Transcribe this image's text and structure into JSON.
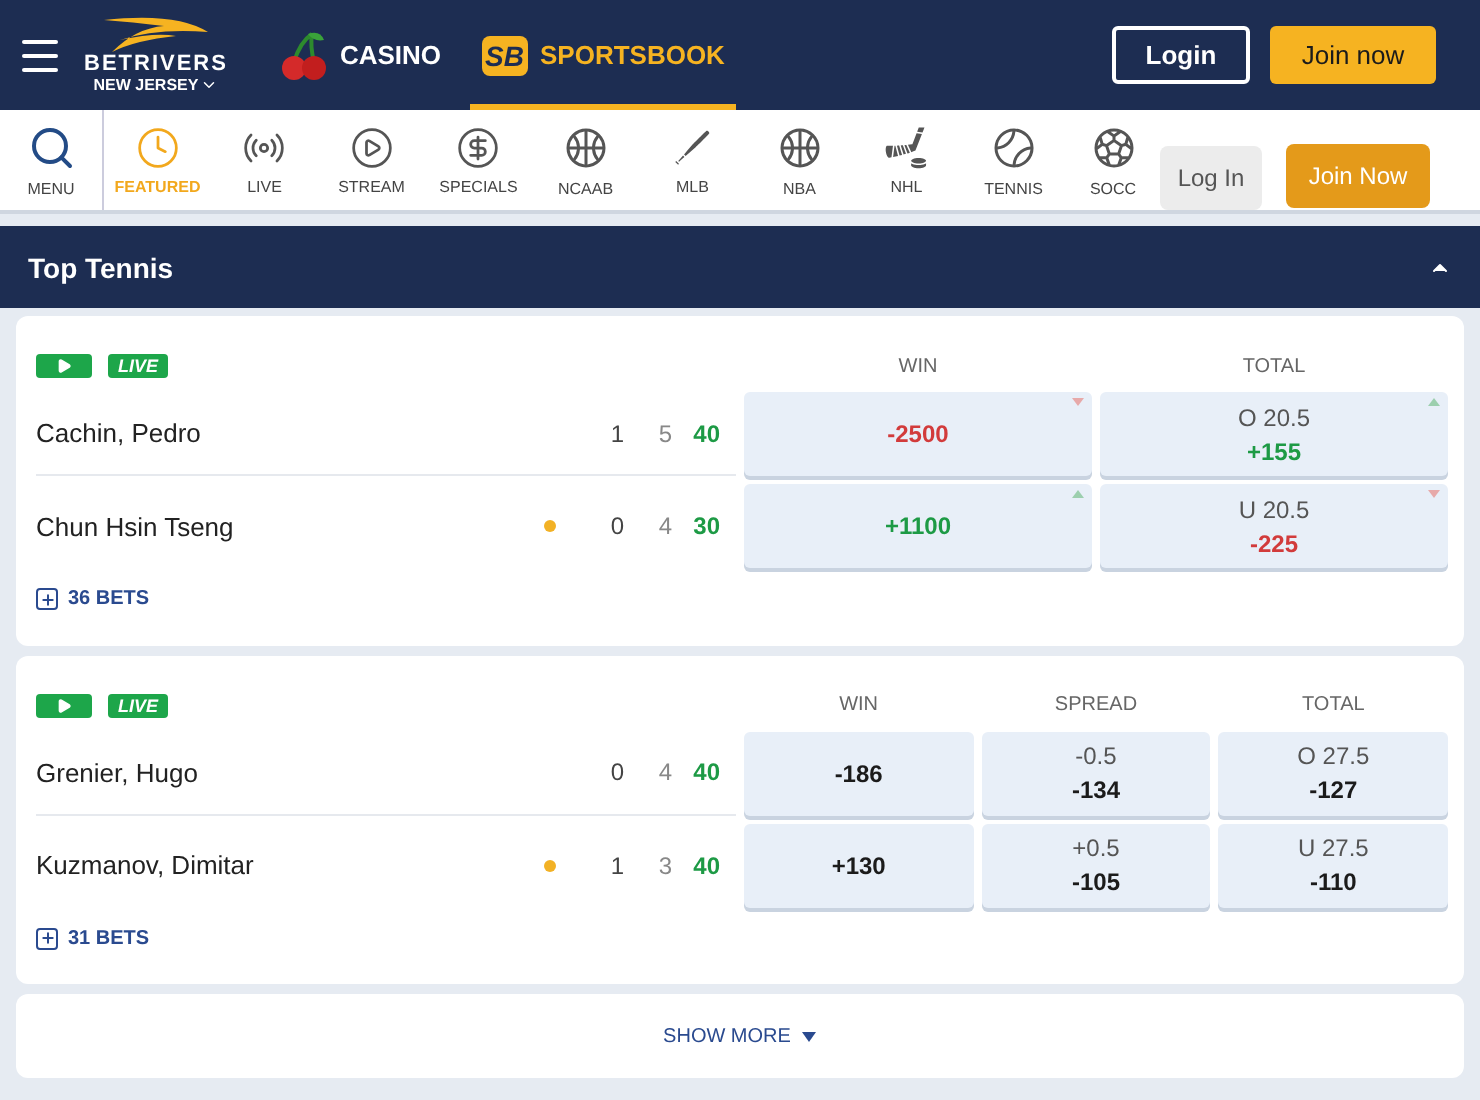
{
  "header": {
    "brand": "BETRIVERS",
    "region": "NEW JERSEY",
    "products": [
      {
        "kind": "casino",
        "label": "CASINO",
        "selected": false
      },
      {
        "kind": "sportsbook",
        "logo": "SB",
        "label": "SPORTSBOOK",
        "selected": true
      }
    ],
    "login": "Login",
    "join": "Join now"
  },
  "nav": {
    "items": [
      {
        "kind": "search",
        "label": "MENU",
        "selected": false
      },
      {
        "kind": "clock",
        "label": "FEATURED",
        "selected": true
      },
      {
        "kind": "live",
        "label": "LIVE",
        "selected": false
      },
      {
        "kind": "stream",
        "label": "STREAM",
        "selected": false
      },
      {
        "kind": "dollar",
        "label": "SPECIALS",
        "selected": false
      },
      {
        "kind": "basketball",
        "label": "NCAAB",
        "selected": false
      },
      {
        "kind": "bat",
        "label": "MLB",
        "selected": false
      },
      {
        "kind": "basketball",
        "label": "NBA",
        "selected": false
      },
      {
        "kind": "hockey",
        "label": "NHL",
        "selected": false
      },
      {
        "kind": "tennis",
        "label": "TENNIS",
        "selected": false
      },
      {
        "kind": "soccer",
        "label": "SOCC",
        "selected": false
      }
    ],
    "overlay_login": "Log In",
    "overlay_join": "Join Now"
  },
  "section": {
    "title": "Top Tennis",
    "expanded": true
  },
  "matches": [
    {
      "badge": "LIVE",
      "columns": [
        "WIN",
        "TOTAL"
      ],
      "bets": "36 BETS",
      "players": [
        {
          "name": "Cachin, Pedro",
          "serving": false,
          "scores": [
            "1",
            "5",
            "40"
          ],
          "odds": [
            {
              "price": "-2500",
              "rising": false,
              "falling": true
            },
            {
              "line": "O 20.5",
              "price": "+155",
              "rising": true,
              "falling": false
            }
          ]
        },
        {
          "name": "Chun Hsin Tseng",
          "serving": true,
          "scores": [
            "0",
            "4",
            "30"
          ],
          "odds": [
            {
              "price": "+1100",
              "rising": true,
              "falling": false
            },
            {
              "line": "U 20.5",
              "price": "-225",
              "rising": false,
              "falling": true
            }
          ]
        }
      ]
    },
    {
      "badge": "LIVE",
      "columns": [
        "WIN",
        "SPREAD",
        "TOTAL"
      ],
      "bets": "31 BETS",
      "players": [
        {
          "name": "Grenier, Hugo",
          "serving": false,
          "scores": [
            "0",
            "4",
            "40"
          ],
          "odds": [
            {
              "price": "-186",
              "rising": false,
              "falling": false
            },
            {
              "line": "-0.5",
              "price": "-134",
              "rising": false,
              "falling": false
            },
            {
              "line": "O 27.5",
              "price": "-127",
              "rising": false,
              "falling": false
            }
          ]
        },
        {
          "name": "Kuzmanov, Dimitar",
          "serving": true,
          "scores": [
            "1",
            "3",
            "40"
          ],
          "odds": [
            {
              "price": "+130",
              "rising": false,
              "falling": false
            },
            {
              "line": "+0.5",
              "price": "-105",
              "rising": false,
              "falling": false
            },
            {
              "line": "U 27.5",
              "price": "-110",
              "rising": false,
              "falling": false
            }
          ]
        }
      ]
    }
  ],
  "show_more": "SHOW MORE"
}
